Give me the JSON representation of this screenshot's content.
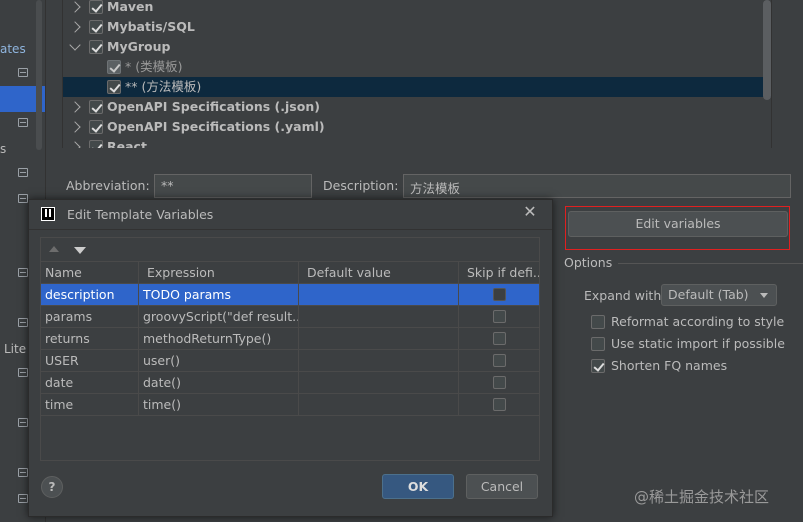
{
  "sidebar": {
    "fragments": [
      "ates",
      "s",
      "Lite"
    ]
  },
  "tree": {
    "items": [
      {
        "label": "Maven"
      },
      {
        "label": "Mybatis/SQL"
      },
      {
        "label": "MyGroup"
      },
      {
        "label": "* (类模板)"
      },
      {
        "label": "** (方法模板)"
      },
      {
        "label": "OpenAPI Specifications (.json)"
      },
      {
        "label": "OpenAPI Specifications (.yaml)"
      },
      {
        "label": "React"
      }
    ]
  },
  "form": {
    "abbreviation_label": "Abbreviation:",
    "abbreviation_value": "**",
    "description_label": "Description:",
    "description_value": "方法模板"
  },
  "right": {
    "edit_variables_label": "Edit variables",
    "options_title": "Options",
    "expand_label": "Expand with",
    "expand_value": "Default (Tab)",
    "options": [
      {
        "label": "Reformat according to style",
        "checked": false
      },
      {
        "label": "Use static import if possible",
        "checked": false
      },
      {
        "label": "Shorten FQ names",
        "checked": true
      }
    ]
  },
  "dialog": {
    "title": "Edit Template Variables",
    "close_glyph": "✕",
    "columns": [
      "Name",
      "Expression",
      "Default value",
      "Skip if defi..."
    ],
    "rows": [
      {
        "name": "description",
        "expression": "TODO params",
        "default": "",
        "skip": false
      },
      {
        "name": "params",
        "expression": "groovyScript(\"def result...",
        "default": "",
        "skip": false
      },
      {
        "name": "returns",
        "expression": "methodReturnType()",
        "default": "",
        "skip": false
      },
      {
        "name": "USER",
        "expression": "user()",
        "default": "",
        "skip": false
      },
      {
        "name": "date",
        "expression": "date()",
        "default": "",
        "skip": false
      },
      {
        "name": "time",
        "expression": "time()",
        "default": "",
        "skip": false
      }
    ],
    "help_label": "?",
    "ok_label": "OK",
    "cancel_label": "Cancel"
  },
  "watermark": "@稀土掘金技术社区",
  "colors": {
    "background": "#3c3f41",
    "selection": "#2f65ca",
    "highlight_outline": "#e02020",
    "primary_button": "#365880"
  }
}
